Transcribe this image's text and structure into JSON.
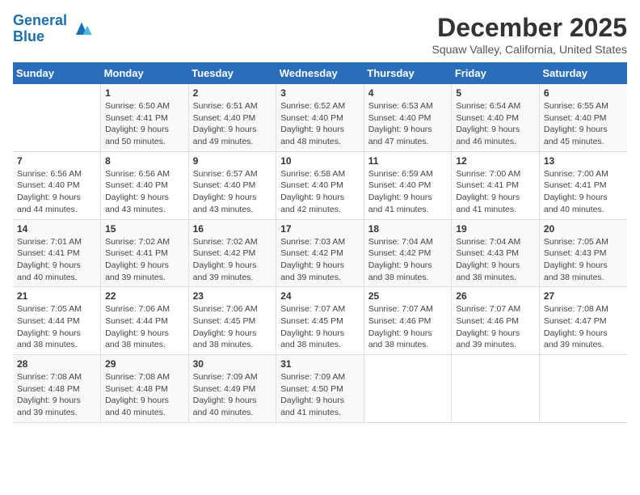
{
  "logo": {
    "line1": "General",
    "line2": "Blue"
  },
  "title": "December 2025",
  "subtitle": "Squaw Valley, California, United States",
  "days_of_week": [
    "Sunday",
    "Monday",
    "Tuesday",
    "Wednesday",
    "Thursday",
    "Friday",
    "Saturday"
  ],
  "weeks": [
    [
      {
        "num": "",
        "info": ""
      },
      {
        "num": "1",
        "info": "Sunrise: 6:50 AM\nSunset: 4:41 PM\nDaylight: 9 hours\nand 50 minutes."
      },
      {
        "num": "2",
        "info": "Sunrise: 6:51 AM\nSunset: 4:40 PM\nDaylight: 9 hours\nand 49 minutes."
      },
      {
        "num": "3",
        "info": "Sunrise: 6:52 AM\nSunset: 4:40 PM\nDaylight: 9 hours\nand 48 minutes."
      },
      {
        "num": "4",
        "info": "Sunrise: 6:53 AM\nSunset: 4:40 PM\nDaylight: 9 hours\nand 47 minutes."
      },
      {
        "num": "5",
        "info": "Sunrise: 6:54 AM\nSunset: 4:40 PM\nDaylight: 9 hours\nand 46 minutes."
      },
      {
        "num": "6",
        "info": "Sunrise: 6:55 AM\nSunset: 4:40 PM\nDaylight: 9 hours\nand 45 minutes."
      }
    ],
    [
      {
        "num": "7",
        "info": "Sunrise: 6:56 AM\nSunset: 4:40 PM\nDaylight: 9 hours\nand 44 minutes."
      },
      {
        "num": "8",
        "info": "Sunrise: 6:56 AM\nSunset: 4:40 PM\nDaylight: 9 hours\nand 43 minutes."
      },
      {
        "num": "9",
        "info": "Sunrise: 6:57 AM\nSunset: 4:40 PM\nDaylight: 9 hours\nand 43 minutes."
      },
      {
        "num": "10",
        "info": "Sunrise: 6:58 AM\nSunset: 4:40 PM\nDaylight: 9 hours\nand 42 minutes."
      },
      {
        "num": "11",
        "info": "Sunrise: 6:59 AM\nSunset: 4:40 PM\nDaylight: 9 hours\nand 41 minutes."
      },
      {
        "num": "12",
        "info": "Sunrise: 7:00 AM\nSunset: 4:41 PM\nDaylight: 9 hours\nand 41 minutes."
      },
      {
        "num": "13",
        "info": "Sunrise: 7:00 AM\nSunset: 4:41 PM\nDaylight: 9 hours\nand 40 minutes."
      }
    ],
    [
      {
        "num": "14",
        "info": "Sunrise: 7:01 AM\nSunset: 4:41 PM\nDaylight: 9 hours\nand 40 minutes."
      },
      {
        "num": "15",
        "info": "Sunrise: 7:02 AM\nSunset: 4:41 PM\nDaylight: 9 hours\nand 39 minutes."
      },
      {
        "num": "16",
        "info": "Sunrise: 7:02 AM\nSunset: 4:42 PM\nDaylight: 9 hours\nand 39 minutes."
      },
      {
        "num": "17",
        "info": "Sunrise: 7:03 AM\nSunset: 4:42 PM\nDaylight: 9 hours\nand 39 minutes."
      },
      {
        "num": "18",
        "info": "Sunrise: 7:04 AM\nSunset: 4:42 PM\nDaylight: 9 hours\nand 38 minutes."
      },
      {
        "num": "19",
        "info": "Sunrise: 7:04 AM\nSunset: 4:43 PM\nDaylight: 9 hours\nand 38 minutes."
      },
      {
        "num": "20",
        "info": "Sunrise: 7:05 AM\nSunset: 4:43 PM\nDaylight: 9 hours\nand 38 minutes."
      }
    ],
    [
      {
        "num": "21",
        "info": "Sunrise: 7:05 AM\nSunset: 4:44 PM\nDaylight: 9 hours\nand 38 minutes."
      },
      {
        "num": "22",
        "info": "Sunrise: 7:06 AM\nSunset: 4:44 PM\nDaylight: 9 hours\nand 38 minutes."
      },
      {
        "num": "23",
        "info": "Sunrise: 7:06 AM\nSunset: 4:45 PM\nDaylight: 9 hours\nand 38 minutes."
      },
      {
        "num": "24",
        "info": "Sunrise: 7:07 AM\nSunset: 4:45 PM\nDaylight: 9 hours\nand 38 minutes."
      },
      {
        "num": "25",
        "info": "Sunrise: 7:07 AM\nSunset: 4:46 PM\nDaylight: 9 hours\nand 38 minutes."
      },
      {
        "num": "26",
        "info": "Sunrise: 7:07 AM\nSunset: 4:46 PM\nDaylight: 9 hours\nand 39 minutes."
      },
      {
        "num": "27",
        "info": "Sunrise: 7:08 AM\nSunset: 4:47 PM\nDaylight: 9 hours\nand 39 minutes."
      }
    ],
    [
      {
        "num": "28",
        "info": "Sunrise: 7:08 AM\nSunset: 4:48 PM\nDaylight: 9 hours\nand 39 minutes."
      },
      {
        "num": "29",
        "info": "Sunrise: 7:08 AM\nSunset: 4:48 PM\nDaylight: 9 hours\nand 40 minutes."
      },
      {
        "num": "30",
        "info": "Sunrise: 7:09 AM\nSunset: 4:49 PM\nDaylight: 9 hours\nand 40 minutes."
      },
      {
        "num": "31",
        "info": "Sunrise: 7:09 AM\nSunset: 4:50 PM\nDaylight: 9 hours\nand 41 minutes."
      },
      {
        "num": "",
        "info": ""
      },
      {
        "num": "",
        "info": ""
      },
      {
        "num": "",
        "info": ""
      }
    ]
  ]
}
